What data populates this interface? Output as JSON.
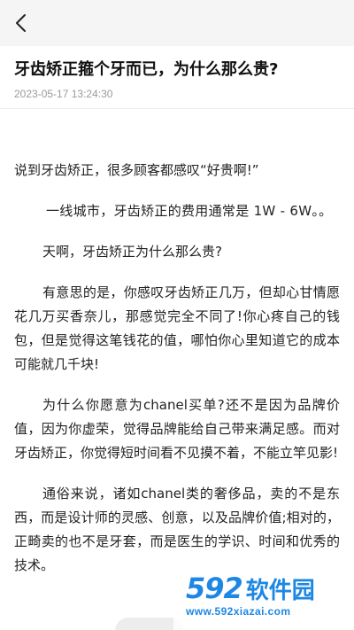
{
  "nav": {
    "back_icon": "chevron-left-icon"
  },
  "article": {
    "title": "牙齿矫正箍个牙而已，为什么那么贵?",
    "date": "2023-05-17 13:24:30",
    "paragraphs": [
      "说到牙齿矫正，很多顾客都感叹“好贵啊!”",
      "一线城市，牙齿矫正的费用通常是 1W - 6W。。",
      "天啊，牙齿矫正为什么那么贵?",
      "有意思的是，你感叹牙齿矫正几万，但却心甘情愿花几万买香奈儿，那感觉完全不同了!你心疼自己的钱包，但是觉得这笔钱花的值，哪怕你心里知道它的成本可能就几千块!",
      "为什么你愿意为chanel买单?还不是因为品牌价值，因为你虚荣，觉得品牌能给自己带来满足感。而对牙齿矫正，你觉得短时间看不见摸不着，不能立竿见影!",
      "通俗来说，诸如chanel类的奢侈品，卖的不是东西，而是设计师的灵感、创意，以及品牌价值;相对的，正畸卖的也不是牙套，而是医生的学识、时间和优秀的技术。"
    ]
  },
  "watermark": {
    "number": "592",
    "name": "软件园",
    "url": "www.592xiazai.com"
  },
  "colors": {
    "nav_bg": "#f5f5f5",
    "watermark_blue": "#1d87e4"
  }
}
